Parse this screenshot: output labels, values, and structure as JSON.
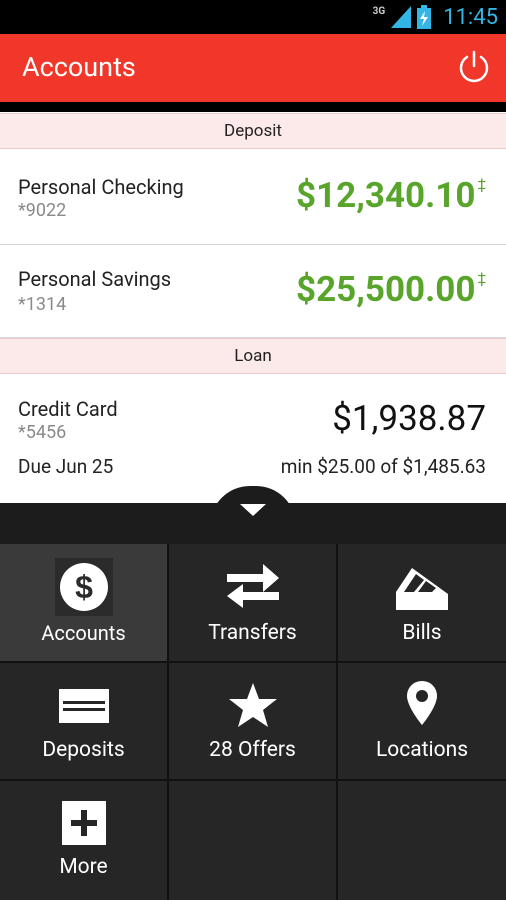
{
  "status": {
    "network": "3G",
    "time": "11:45"
  },
  "appbar": {
    "title": "Accounts"
  },
  "sections": {
    "deposit": "Deposit",
    "loan": "Loan"
  },
  "accounts": [
    {
      "name": "Personal Checking",
      "number": "*9022",
      "amount": "$12,340.10",
      "mark": "‡"
    },
    {
      "name": "Personal Savings",
      "number": "*1314",
      "amount": "$25,500.00",
      "mark": "‡"
    }
  ],
  "loan": {
    "name": "Credit Card",
    "number": "*5456",
    "amount": "$1,938.87",
    "due": "Due Jun 25",
    "min": "min $25.00 of $1,485.63"
  },
  "menu": [
    {
      "label": "Accounts",
      "icon": "dollar-icon"
    },
    {
      "label": "Transfers",
      "icon": "transfer-arrows-icon"
    },
    {
      "label": "Bills",
      "icon": "bills-icon"
    },
    {
      "label": "Deposits",
      "icon": "check-icon"
    },
    {
      "label": "28 Offers",
      "icon": "star-icon"
    },
    {
      "label": "Locations",
      "icon": "location-pin-icon"
    },
    {
      "label": "More",
      "icon": "plus-icon"
    }
  ],
  "colors": {
    "accent": "#f1362a",
    "amount_green": "#59a52c",
    "drawer": "#1c1c1c"
  }
}
